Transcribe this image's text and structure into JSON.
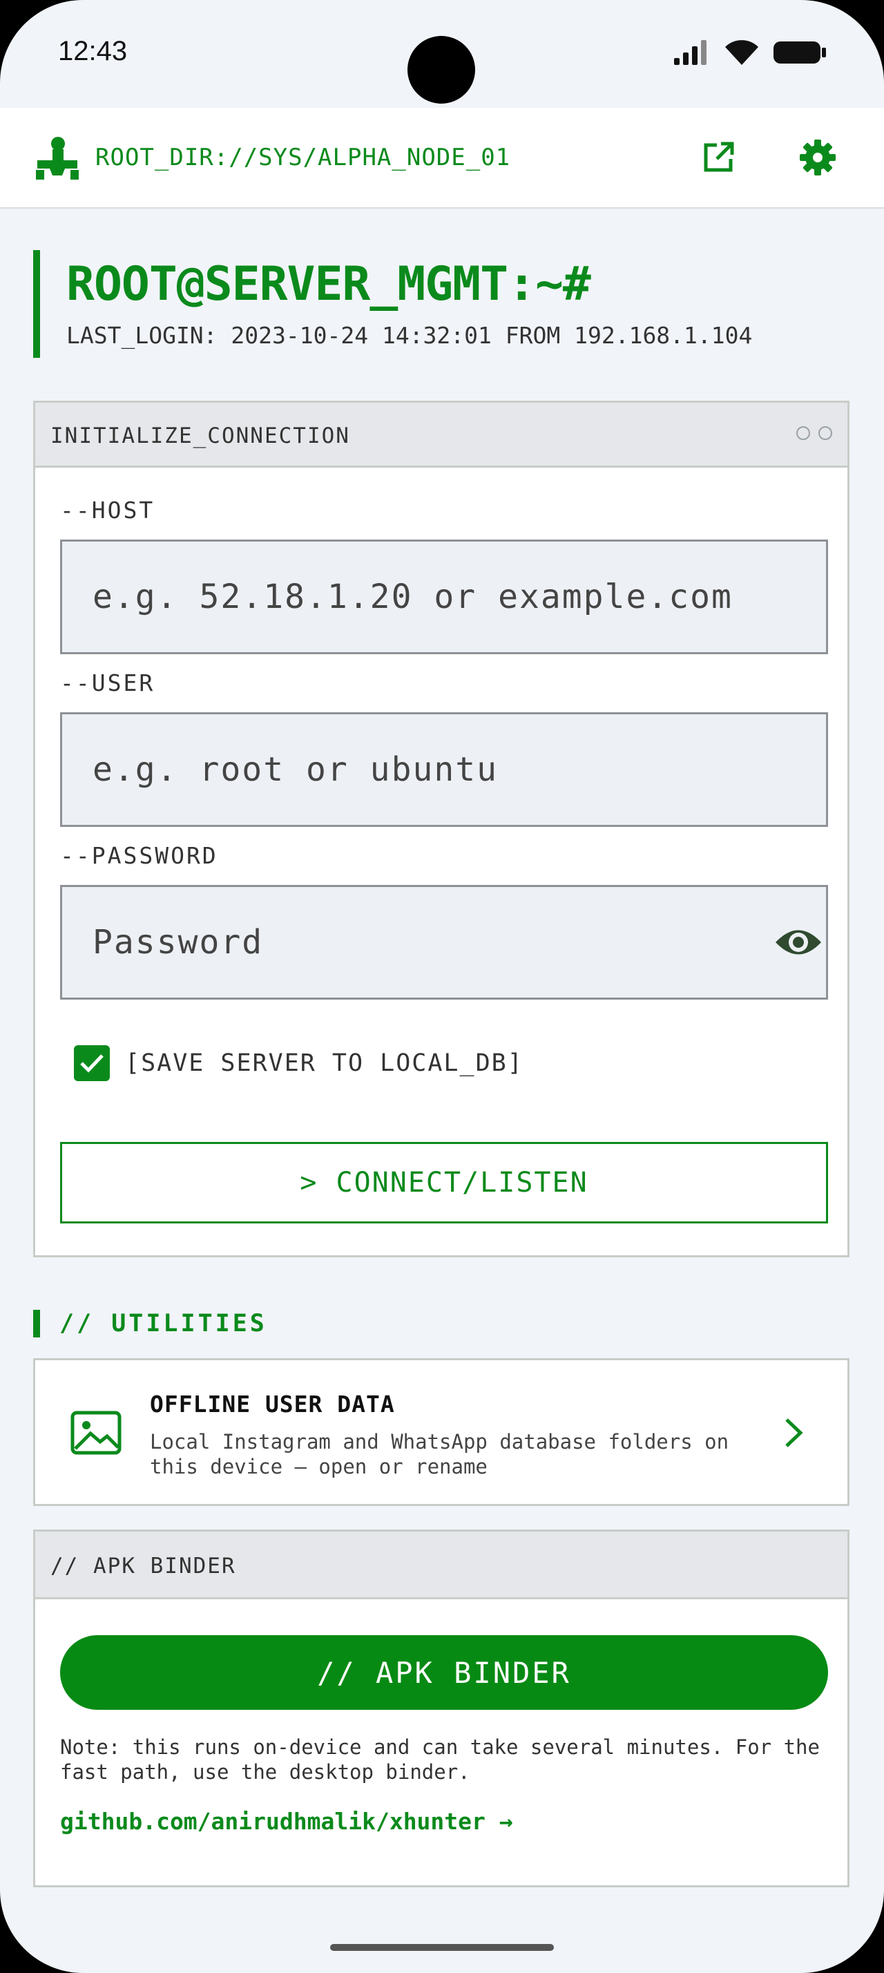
{
  "status_bar": {
    "time": "12:43"
  },
  "app_bar": {
    "title": "ROOT_DIR://SYS/ALPHA_NODE_01"
  },
  "hero": {
    "title": "ROOT@SERVER_MGMT:~#",
    "subtitle": "LAST_LOGIN: 2023-10-24 14:32:01 FROM 192.168.1.104"
  },
  "connection_panel": {
    "title": "INITIALIZE_CONNECTION",
    "host_label": "--HOST",
    "host_placeholder": "e.g. 52.18.1.20 or example.com",
    "user_label": "--USER",
    "user_placeholder": "e.g. root or ubuntu",
    "password_label": "--PASSWORD",
    "password_placeholder": "Password",
    "save_label": "[SAVE SERVER TO LOCAL_DB]",
    "save_checked": true,
    "connect_label": "> CONNECT/LISTEN"
  },
  "utilities": {
    "section_title": "// UTILITIES",
    "offline_title": "OFFLINE USER DATA",
    "offline_desc": "Local Instagram and WhatsApp database folders on this device — open or rename"
  },
  "apk_binder": {
    "panel_title": "// APK BINDER",
    "button_label": "// APK BINDER",
    "note": "Note: this runs on-device and can take several minutes. For the fast path, use the desktop binder.",
    "link": "github.com/anirudhmalik/xhunter →"
  },
  "colors": {
    "accent": "#0b8a1c",
    "background": "#f1f4f9",
    "panel_header": "#e5e7ea"
  },
  "icons": [
    "signal-icon",
    "wifi-icon",
    "battery-icon",
    "app-logo-icon",
    "open-external-icon",
    "gear-icon",
    "eye-icon",
    "check-icon",
    "image-icon",
    "chevron-right-icon"
  ]
}
